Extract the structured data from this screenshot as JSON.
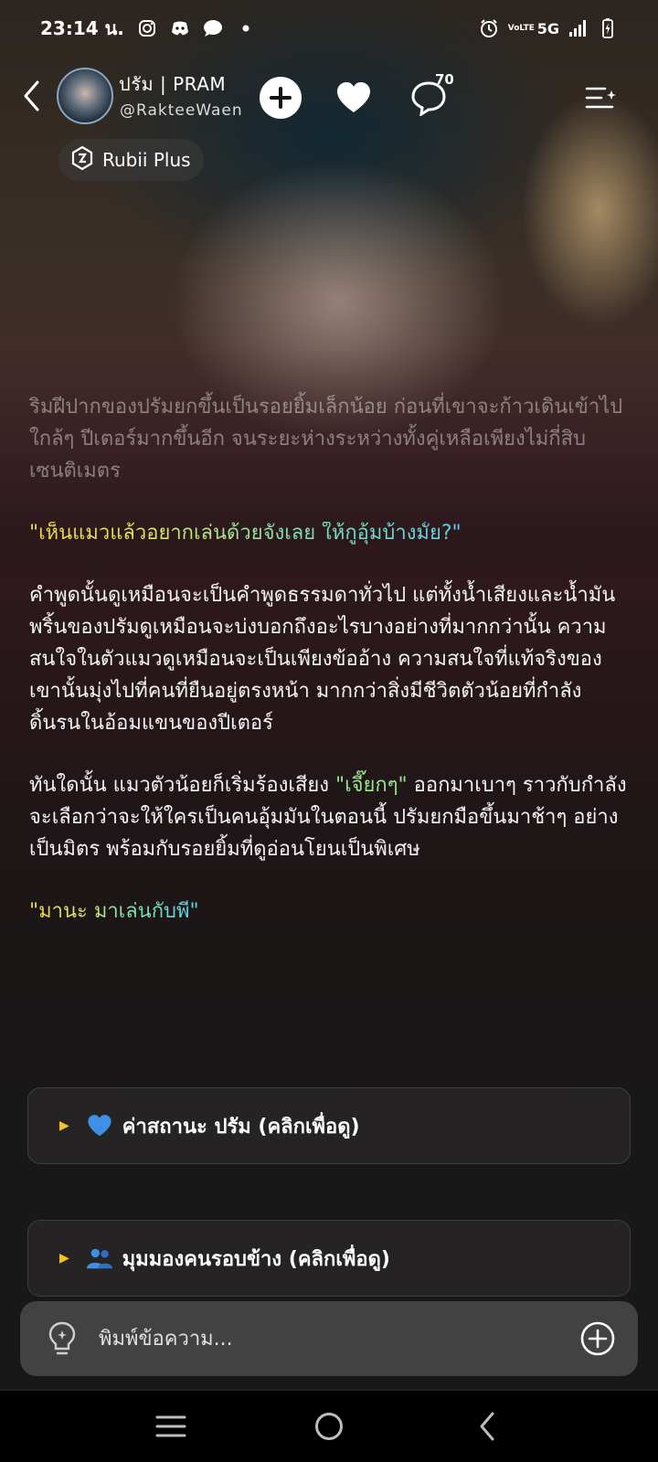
{
  "status_bar": {
    "time": "23:14 น.",
    "network": "5G",
    "volte": "VoLTE"
  },
  "header": {
    "name": "ปรัม | PRAM",
    "handle": "@RakteeWaen",
    "comment_count": "70",
    "badge_label": "Rubii Plus"
  },
  "story": {
    "paragraph_1": "ริมฝีปากของปรัมยกขึ้นเป็นรอยยิ้มเล็กน้อย ก่อนที่เขาจะก้าวเดินเข้าไปใกล้ๆ ปีเตอร์มากขึ้นอีก จนระยะห่างระหว่างทั้งคู่เหลือเพียงไม่กี่สิบเซนติเมตร",
    "quote_1": "\"เห็นแมวแล้วอยากเล่นด้วยจังเลย ให้กูอุ้มบ้างมั้ย?\"",
    "paragraph_2": "คำพูดนั้นดูเหมือนจะเป็นคำพูดธรรมดาทั่วไป แต่ทั้งน้ำเสียงและน้ำมันพริ้นของปรัมดูเหมือนจะบ่งบอกถึงอะไรบางอย่างที่มากกว่านั้น ความสนใจในตัวแมวดูเหมือนจะเป็นเพียงข้ออ้าง ความสนใจที่แท้จริงของเขานั้นมุ่งไปที่คนที่ยืนอยู่ตรงหน้า มากกว่าสิ่งมีชีวิตตัวน้อยที่กำลังดิ้นรนในอ้อมแขนของปีเตอร์",
    "paragraph_3_before": "ทันใดนั้น แมวตัวน้อยก็เริ่มร้องเสียง ",
    "paragraph_3_quote": "\"เจี๊ยกๆ\"",
    "paragraph_3_after": " ออกมาเบาๆ ราวกับกำลังจะเลือกว่าจะให้ใครเป็นคนอุ้มมันในตอนนี้ ปรัมยกมือขึ้นมาช้าๆ อย่างเป็นมิตร พร้อมกับรอยยิ้มที่ดูอ่อนโยนเป็นพิเศษ",
    "quote_2": "\"มานะ มาเล่นกับพี่\""
  },
  "panels": [
    {
      "label": "ค่าสถานะ ปรัม (คลิกเพื่อดู)",
      "icon": "blue-heart-icon"
    },
    {
      "label": "มุมมองคนรอบข้าง (คลิกเพื่อดู)",
      "icon": "people-icon"
    }
  ],
  "input": {
    "placeholder": "พิมพ์ข้อความ..."
  },
  "colors": {
    "accent_yellow": "#f5c518",
    "quote_green": "#9be07a",
    "blue_heart": "#3f8fe6"
  }
}
